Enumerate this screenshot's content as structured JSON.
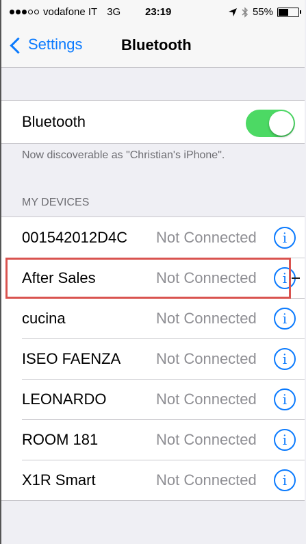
{
  "status_bar": {
    "carrier": "vodafone IT",
    "network": "3G",
    "time": "23:19",
    "battery": "55%",
    "battery_level": 0.55
  },
  "nav": {
    "back_label": "Settings",
    "title": "Bluetooth"
  },
  "bluetooth": {
    "label": "Bluetooth",
    "enabled": true,
    "toggle_color": "#4cd964",
    "discoverable_note": "Now discoverable as \"Christian's iPhone\"."
  },
  "my_devices": {
    "header": "MY DEVICES",
    "devices": [
      {
        "name": "001542012D4C",
        "status": "Not Connected"
      },
      {
        "name": "After Sales",
        "status": "Not Connected"
      },
      {
        "name": "cucina",
        "status": "Not Connected"
      },
      {
        "name": "ISEO FAENZA",
        "status": "Not Connected"
      },
      {
        "name": "LEONARDO",
        "status": "Not Connected"
      },
      {
        "name": "ROOM 181",
        "status": "Not Connected"
      },
      {
        "name": "X1R Smart",
        "status": "Not Connected"
      }
    ]
  },
  "colors": {
    "accent": "#0a7afe",
    "highlight": "#d9534f"
  }
}
